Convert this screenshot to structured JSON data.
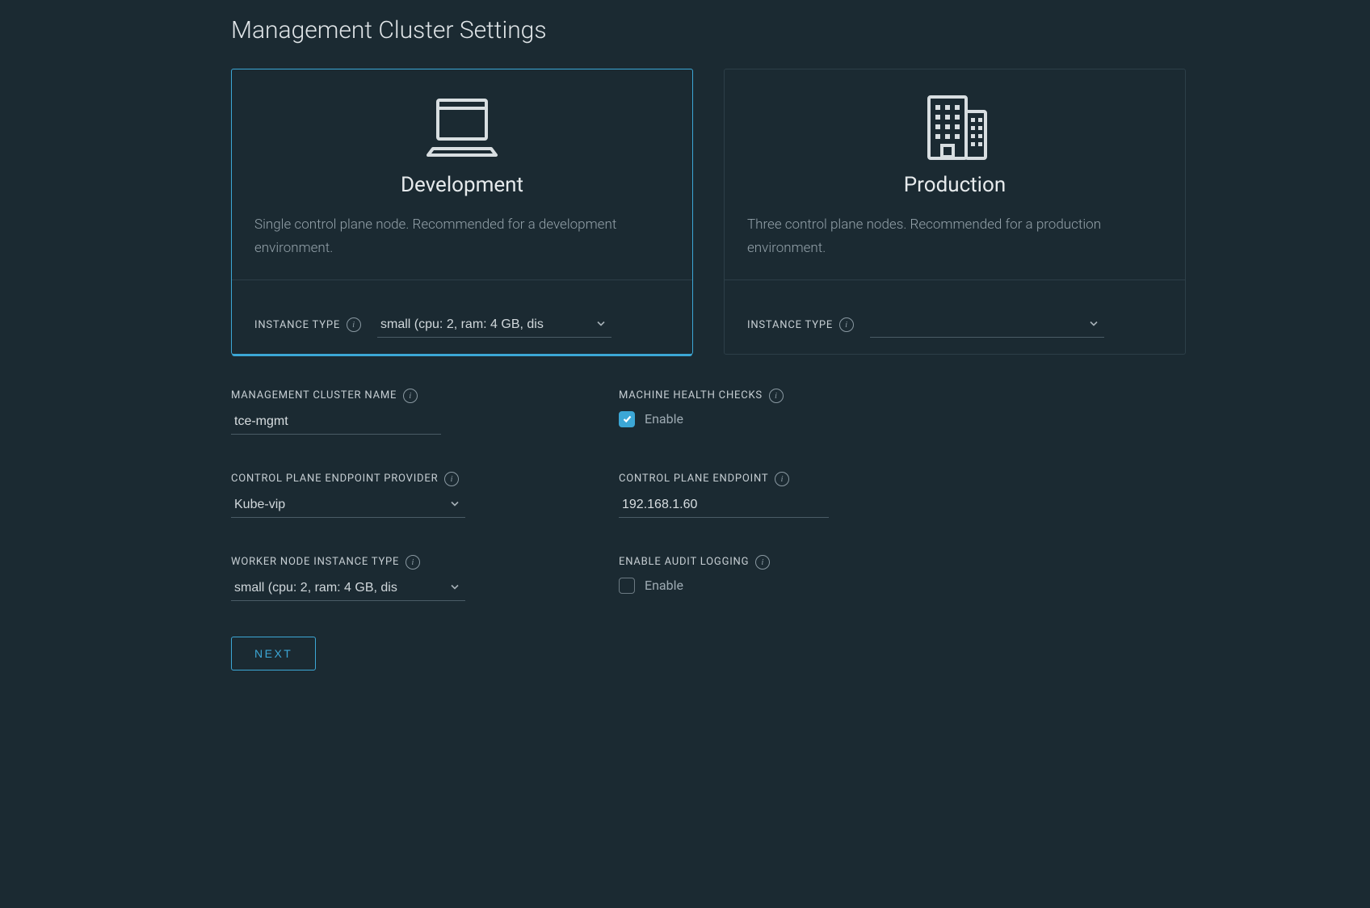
{
  "page_title": "Management Cluster Settings",
  "cards": {
    "dev": {
      "title": "Development",
      "desc": "Single control plane node. Recommended for a development environment.",
      "instance_type_label": "INSTANCE TYPE",
      "instance_type_value": "small (cpu: 2, ram: 4 GB, dis",
      "selected": true
    },
    "prod": {
      "title": "Production",
      "desc": "Three control plane nodes. Recommended for a production environment.",
      "instance_type_label": "INSTANCE TYPE",
      "instance_type_value": "",
      "selected": false
    }
  },
  "form": {
    "cluster_name_label": "MANAGEMENT CLUSTER NAME",
    "cluster_name_value": "tce-mgmt",
    "mhc_label": "MACHINE HEALTH CHECKS",
    "mhc_enable_label": "Enable",
    "mhc_checked": true,
    "cpe_provider_label": "CONTROL PLANE ENDPOINT PROVIDER",
    "cpe_provider_value": "Kube-vip",
    "cpe_label": "CONTROL PLANE ENDPOINT",
    "cpe_value": "192.168.1.60",
    "worker_type_label": "WORKER NODE INSTANCE TYPE",
    "worker_type_value": "small (cpu: 2, ram: 4 GB, dis",
    "audit_label": "ENABLE AUDIT LOGGING",
    "audit_enable_label": "Enable",
    "audit_checked": false
  },
  "next_label": "NEXT"
}
